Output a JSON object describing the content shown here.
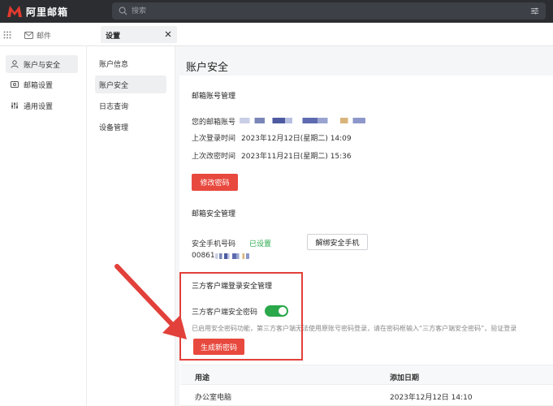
{
  "app": {
    "name": "阿里邮箱",
    "brand_color": "#e63a2e"
  },
  "search": {
    "placeholder": "搜索"
  },
  "tabs": {
    "mail": "邮件",
    "settings": "设置"
  },
  "left_nav": {
    "items": [
      {
        "label": "账户与安全",
        "icon": "user-icon",
        "active": true
      },
      {
        "label": "邮箱设置",
        "icon": "mail-settings-icon",
        "active": false
      },
      {
        "label": "通用设置",
        "icon": "sliders-icon",
        "active": false
      }
    ]
  },
  "sub_nav": {
    "items": [
      {
        "label": "账户信息",
        "active": false
      },
      {
        "label": "账户安全",
        "active": true
      },
      {
        "label": "日志查询",
        "active": false
      },
      {
        "label": "设备管理",
        "active": false
      }
    ]
  },
  "page": {
    "title": "账户安全",
    "account_section": {
      "title": "邮箱账号管理",
      "account_label": "您的邮箱账号",
      "last_login_label": "上次登录时间",
      "last_login_value": "2023年12月12日(星期二) 14:09",
      "last_pwd_label": "上次改密时间",
      "last_pwd_value": "2023年11月21日(星期二) 15:36",
      "change_pwd_button": "修改密码"
    },
    "security_section": {
      "title": "邮箱安全管理",
      "phone_label": "安全手机号码",
      "phone_status": "已设置",
      "phone_value": "00861",
      "unbind_button": "解绑安全手机"
    },
    "third_party_section": {
      "title": "三方客户端登录安全管理",
      "toggle_label": "三方客户端安全密码",
      "toggle_on": true,
      "hint": "已启用安全密码功能，第三方客户端无法使用原账号密码登录，请在密码框输入“三方客户端安全密码”，验证登录",
      "generate_button": "生成新密码"
    },
    "table": {
      "headers": [
        "用途",
        "添加日期"
      ],
      "rows": [
        [
          "办公室电脑",
          "2023年12月12日 14:10"
        ]
      ]
    }
  }
}
